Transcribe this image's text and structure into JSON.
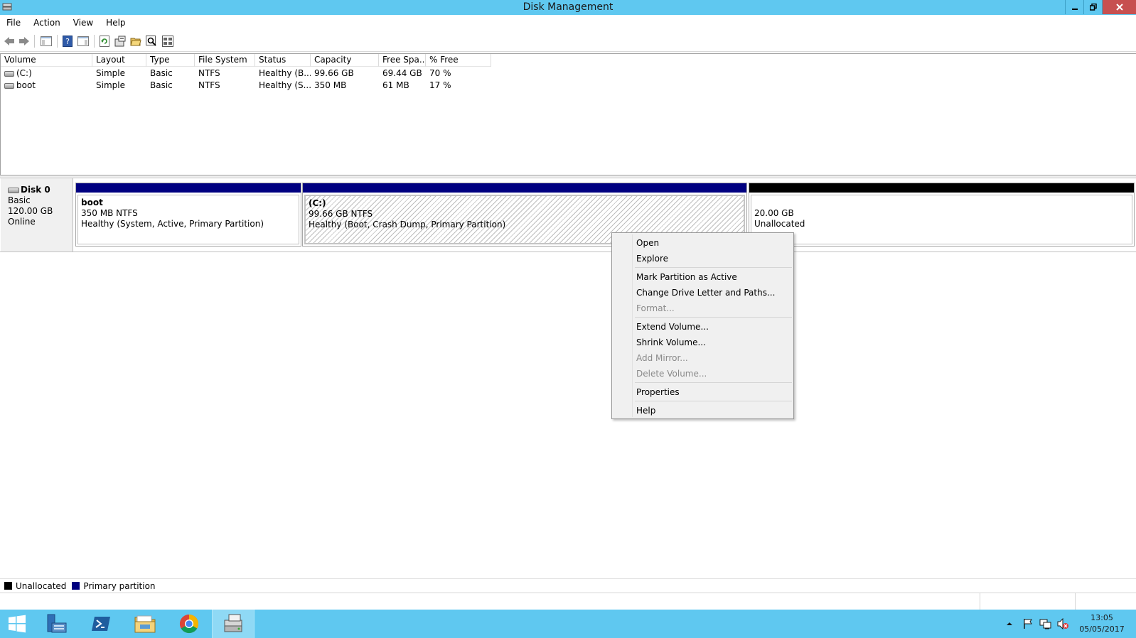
{
  "window": {
    "title": "Disk Management",
    "accent": "#5fc8f0"
  },
  "menubar": {
    "items": [
      "File",
      "Action",
      "View",
      "Help"
    ]
  },
  "toolbar": {
    "buttons": [
      "back-arrow-icon",
      "forward-arrow-icon",
      "console-tree-icon",
      "help-icon",
      "show-pane-icon",
      "refresh-icon",
      "rescan-icon",
      "open-folder-icon",
      "search-icon",
      "properties-icon"
    ]
  },
  "volume_list": {
    "columns": [
      "Volume",
      "Layout",
      "Type",
      "File System",
      "Status",
      "Capacity",
      "Free Spa...",
      "% Free"
    ],
    "rows": [
      {
        "volume": "(C:)",
        "layout": "Simple",
        "type": "Basic",
        "fs": "NTFS",
        "status": "Healthy (B...",
        "capacity": "99.66 GB",
        "free": "69.44 GB",
        "pct": "70 %"
      },
      {
        "volume": "boot",
        "layout": "Simple",
        "type": "Basic",
        "fs": "NTFS",
        "status": "Healthy (S...",
        "capacity": "350 MB",
        "free": "61 MB",
        "pct": "17 %"
      }
    ]
  },
  "disk0": {
    "name": "Disk 0",
    "type": "Basic",
    "size": "120.00 GB",
    "state": "Online",
    "partitions": [
      {
        "name": "boot",
        "size": "350 MB NTFS",
        "status": "Healthy (System, Active, Primary Partition)",
        "color": "#000080"
      },
      {
        "name": "(C:)",
        "size": "99.66 GB NTFS",
        "status": "Healthy (Boot, Crash Dump, Primary Partition)",
        "color": "#000080"
      },
      {
        "name": "",
        "size": "20.00 GB",
        "status": "Unallocated",
        "color": "#000000"
      }
    ]
  },
  "legend": {
    "items": [
      {
        "label": "Unallocated",
        "color": "#000000"
      },
      {
        "label": "Primary partition",
        "color": "#000080"
      }
    ]
  },
  "context_menu": {
    "items": [
      {
        "label": "Open",
        "enabled": true
      },
      {
        "label": "Explore",
        "enabled": true
      },
      {
        "label": "Mark Partition as Active",
        "enabled": true
      },
      {
        "label": "Change Drive Letter and Paths...",
        "enabled": true
      },
      {
        "label": "Format...",
        "enabled": false
      },
      {
        "label": "Extend Volume...",
        "enabled": true
      },
      {
        "label": "Shrink Volume...",
        "enabled": true
      },
      {
        "label": "Add Mirror...",
        "enabled": false
      },
      {
        "label": "Delete Volume...",
        "enabled": false
      },
      {
        "label": "Properties",
        "enabled": true
      },
      {
        "label": "Help",
        "enabled": true
      }
    ]
  },
  "taskbar": {
    "apps": [
      "windows-start-icon",
      "server-manager-icon",
      "powershell-icon",
      "file-explorer-icon",
      "chrome-icon",
      "disk-management-icon"
    ],
    "clock_time": "13:05",
    "clock_date": "05/05/2017"
  }
}
